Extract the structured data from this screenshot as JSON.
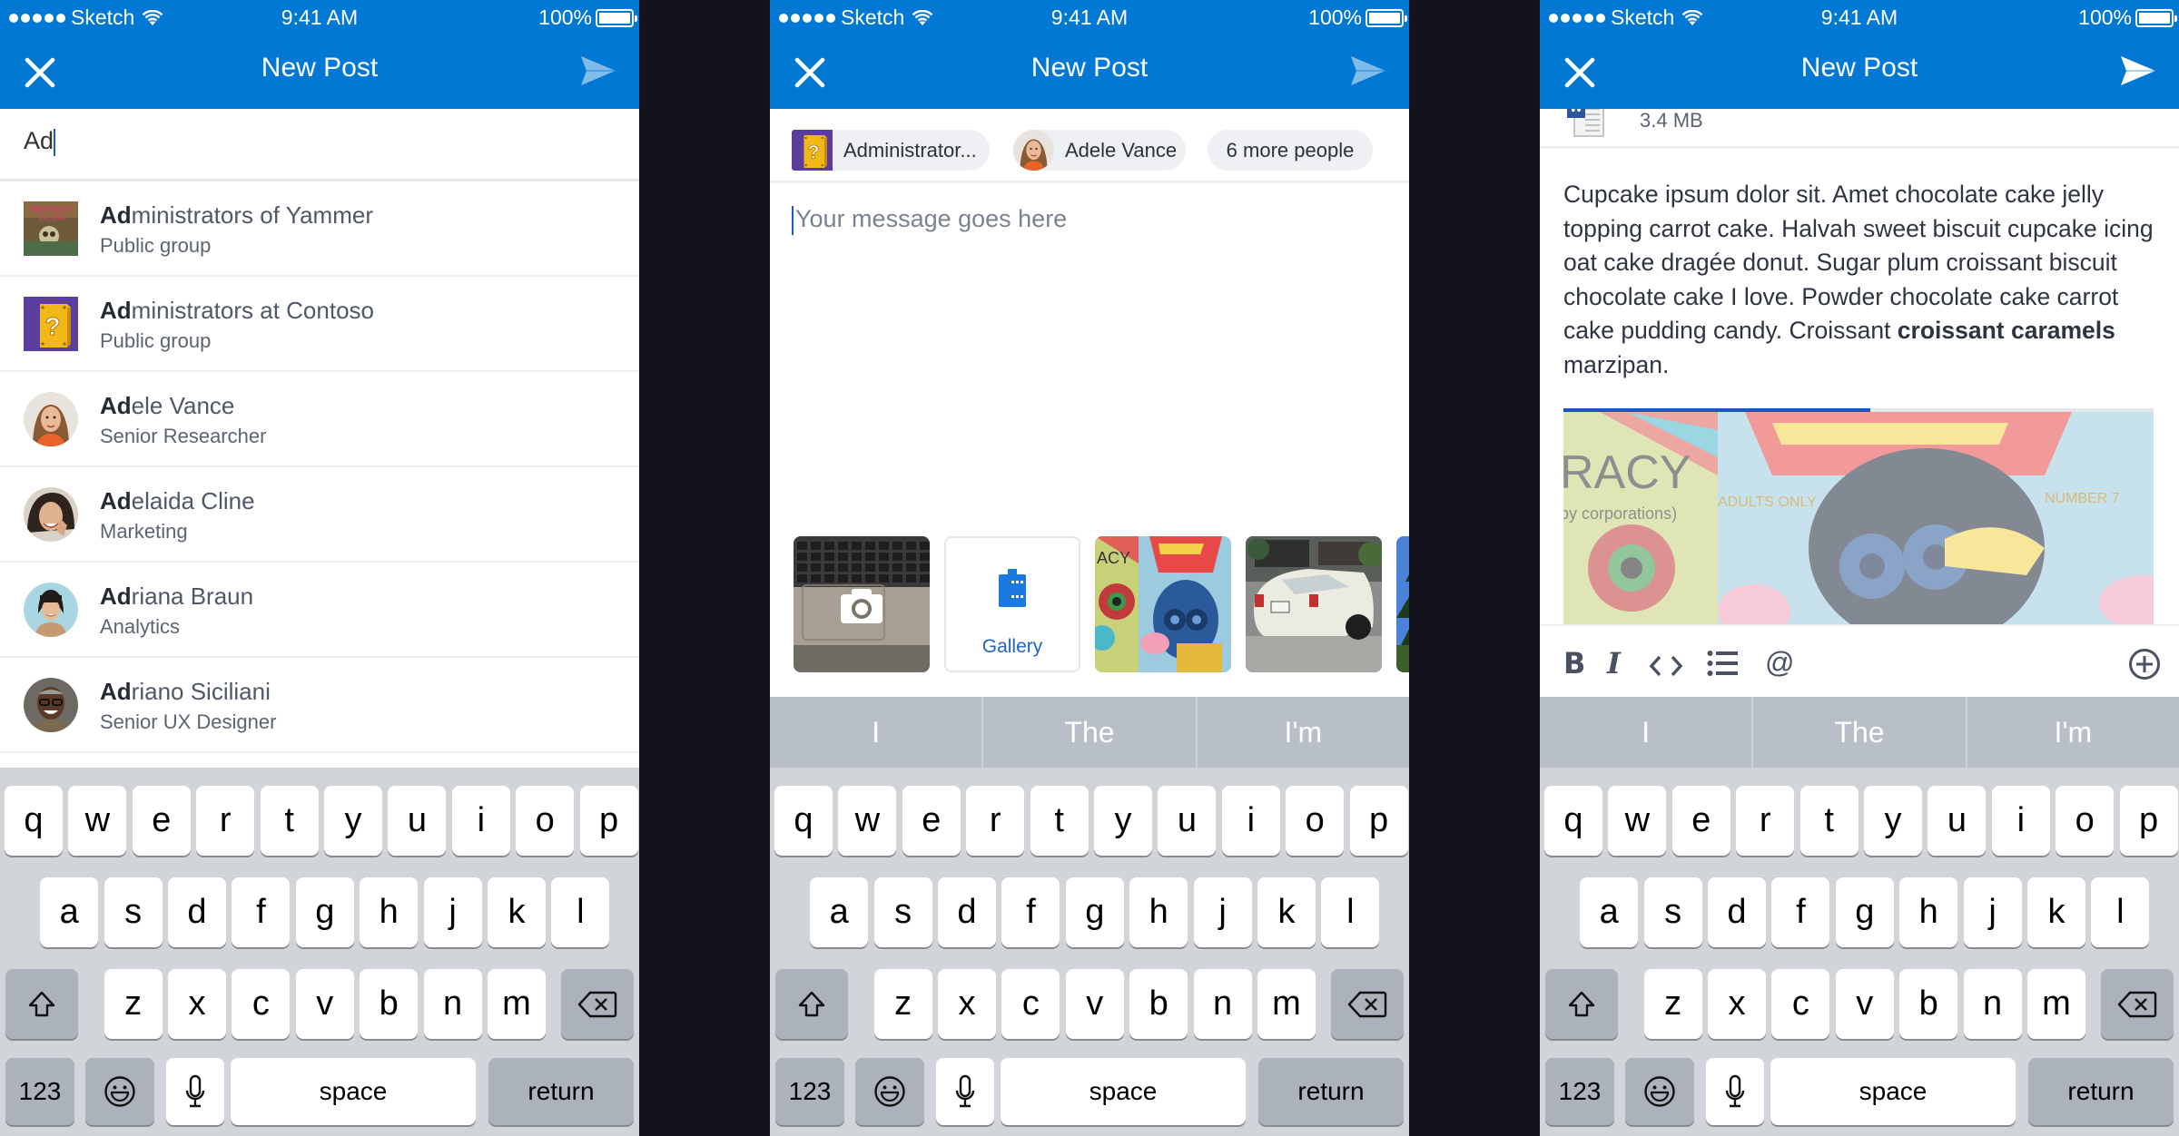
{
  "status_bar": {
    "carrier": "Sketch",
    "time": "9:41 AM",
    "battery": "100%"
  },
  "nav": {
    "title": "New Post",
    "close_icon": "close-icon",
    "send_icon": "send-icon"
  },
  "colors": {
    "brand": "#0078d4",
    "gap": "#12131a",
    "keyboard_bg": "#d1d4d9",
    "suggestion_bg": "#b8bfc8",
    "progress": "#1d56c0"
  },
  "screen1": {
    "search": {
      "value": "Ad",
      "match": "Ad"
    },
    "results": [
      {
        "match": "Ad",
        "rest": "ministrators of Yammer",
        "subtitle": "Public group",
        "avatar": "monkey-island-group-avatar",
        "shape": "square"
      },
      {
        "match": "Ad",
        "rest": "ministrators at Contoso",
        "subtitle": "Public group",
        "avatar": "question-block-group-avatar",
        "shape": "square"
      },
      {
        "match": "Ad",
        "rest": "ele Vance",
        "subtitle": "Senior Researcher",
        "avatar": "adele-vance-avatar",
        "shape": "round"
      },
      {
        "match": "Ad",
        "rest": "elaida Cline",
        "subtitle": "Marketing",
        "avatar": "adelaida-cline-avatar",
        "shape": "round"
      },
      {
        "match": "Ad",
        "rest": "riana Braun",
        "subtitle": "Analytics",
        "avatar": "adriana-braun-avatar",
        "shape": "round"
      },
      {
        "match": "Ad",
        "rest": "riano Siciliani",
        "subtitle": "Senior UX Designer",
        "avatar": "adriano-siciliani-avatar",
        "shape": "round"
      }
    ]
  },
  "screen2": {
    "recipients": [
      {
        "label": "Administrator...",
        "avatar": "question-block-group-avatar"
      },
      {
        "label": "Adele Vance",
        "avatar": "adele-vance-avatar"
      },
      {
        "label": "6 more people"
      }
    ],
    "message_placeholder": "Your message goes here",
    "media": [
      {
        "type": "camera",
        "icon": "camera-icon"
      },
      {
        "type": "gallery",
        "label": "Gallery",
        "icon": "gallery-icon"
      },
      {
        "type": "photo",
        "name": "mural-photo"
      },
      {
        "type": "photo",
        "name": "car-photo"
      },
      {
        "type": "photo",
        "name": "tree-photo"
      }
    ],
    "suggestions": [
      "I",
      "The",
      "I'm"
    ]
  },
  "screen3": {
    "attachment": {
      "icon": "word-document-icon",
      "size": "3.4 MB"
    },
    "body_parts": [
      {
        "text": "Cupcake ipsum dolor sit. Amet chocolate cake jelly topping carrot cake. Halvah sweet biscuit cupcake icing oat cake dragée donut. Sugar plum croissant biscuit chocolate cake I love. Powder chocolate cake carrot cake pudding candy. Croissant ",
        "bold": false
      },
      {
        "text": "croissant caramels",
        "bold": true
      },
      {
        "text": " marzipan.",
        "bold": false
      }
    ],
    "upload_progress": 0.52,
    "format_toolbar": [
      "bold-icon",
      "italic-icon",
      "code-icon",
      "list-icon",
      "mention-icon",
      "add-icon"
    ],
    "format_labels": {
      "bold": "B",
      "italic": "I",
      "code": "<>",
      "mention": "@"
    },
    "suggestions": [
      "I",
      "The",
      "I'm"
    ]
  },
  "keyboard": {
    "row1": [
      "q",
      "w",
      "e",
      "r",
      "t",
      "y",
      "u",
      "i",
      "o",
      "p"
    ],
    "row2": [
      "a",
      "s",
      "d",
      "f",
      "g",
      "h",
      "j",
      "k",
      "l"
    ],
    "row3": [
      "z",
      "x",
      "c",
      "v",
      "b",
      "n",
      "m"
    ],
    "numbers": "123",
    "space": "space",
    "return": "return"
  }
}
